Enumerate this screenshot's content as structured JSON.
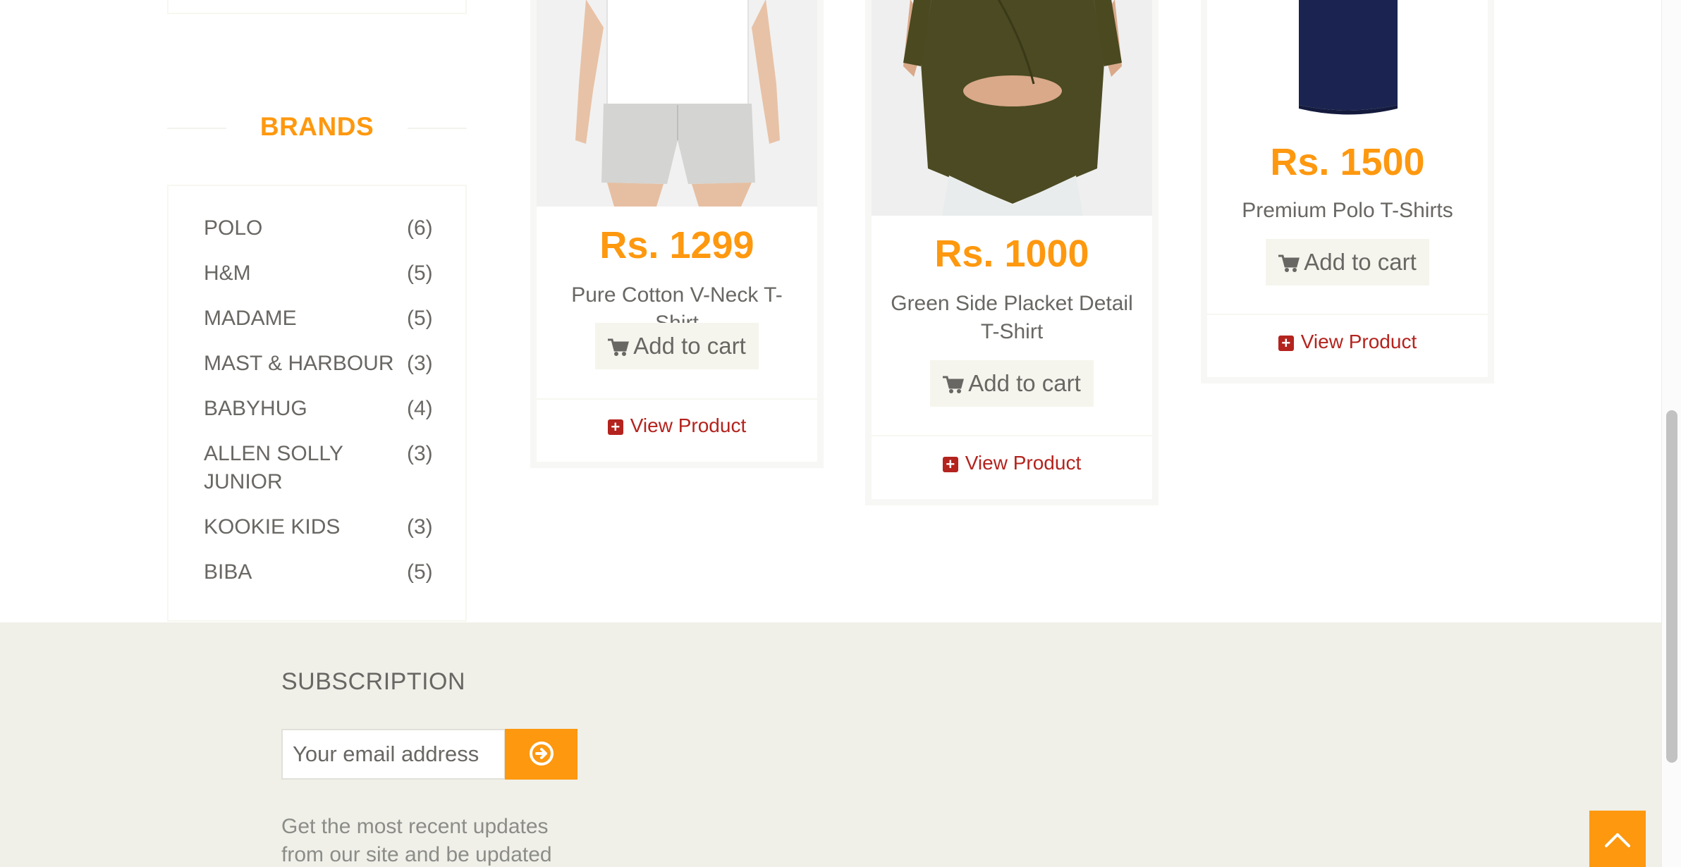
{
  "sidebar": {
    "brands_title": "BRANDS",
    "brands": [
      {
        "name": "POLO",
        "count": "(6)"
      },
      {
        "name": "H&M",
        "count": "(5)"
      },
      {
        "name": "MADAME",
        "count": "(5)"
      },
      {
        "name": "MAST & HARBOUR",
        "count": "(3)"
      },
      {
        "name": "BABYHUG",
        "count": "(4)"
      },
      {
        "name": "ALLEN SOLLY JUNIOR",
        "count": "(3)"
      },
      {
        "name": "KOOKIE KIDS",
        "count": "(3)"
      },
      {
        "name": "BIBA",
        "count": "(5)"
      }
    ]
  },
  "products": [
    {
      "price": "Rs. 1299",
      "name": "Pure Cotton V-Neck T-Shirt",
      "add_to_cart": "Add to cart",
      "view_product": "View Product"
    },
    {
      "price": "Rs. 1000",
      "name": "Green Side Placket Detail T-Shirt",
      "add_to_cart": "Add to cart",
      "view_product": "View Product"
    },
    {
      "price": "Rs. 1500",
      "name": "Premium Polo T-Shirts",
      "add_to_cart": "Add to cart",
      "view_product": "View Product"
    }
  ],
  "footer": {
    "subscription_title": "SUBSCRIPTION",
    "email_placeholder": "Your email address",
    "description": "Get the most recent updates from our site and be updated your"
  },
  "colors": {
    "accent": "#fe980f",
    "view_link": "#b4231e",
    "footer_bg": "#f0f0e9"
  },
  "icons": [
    "cart-icon",
    "plus-square-icon",
    "arrow-circle-right-icon",
    "angle-up-icon"
  ]
}
